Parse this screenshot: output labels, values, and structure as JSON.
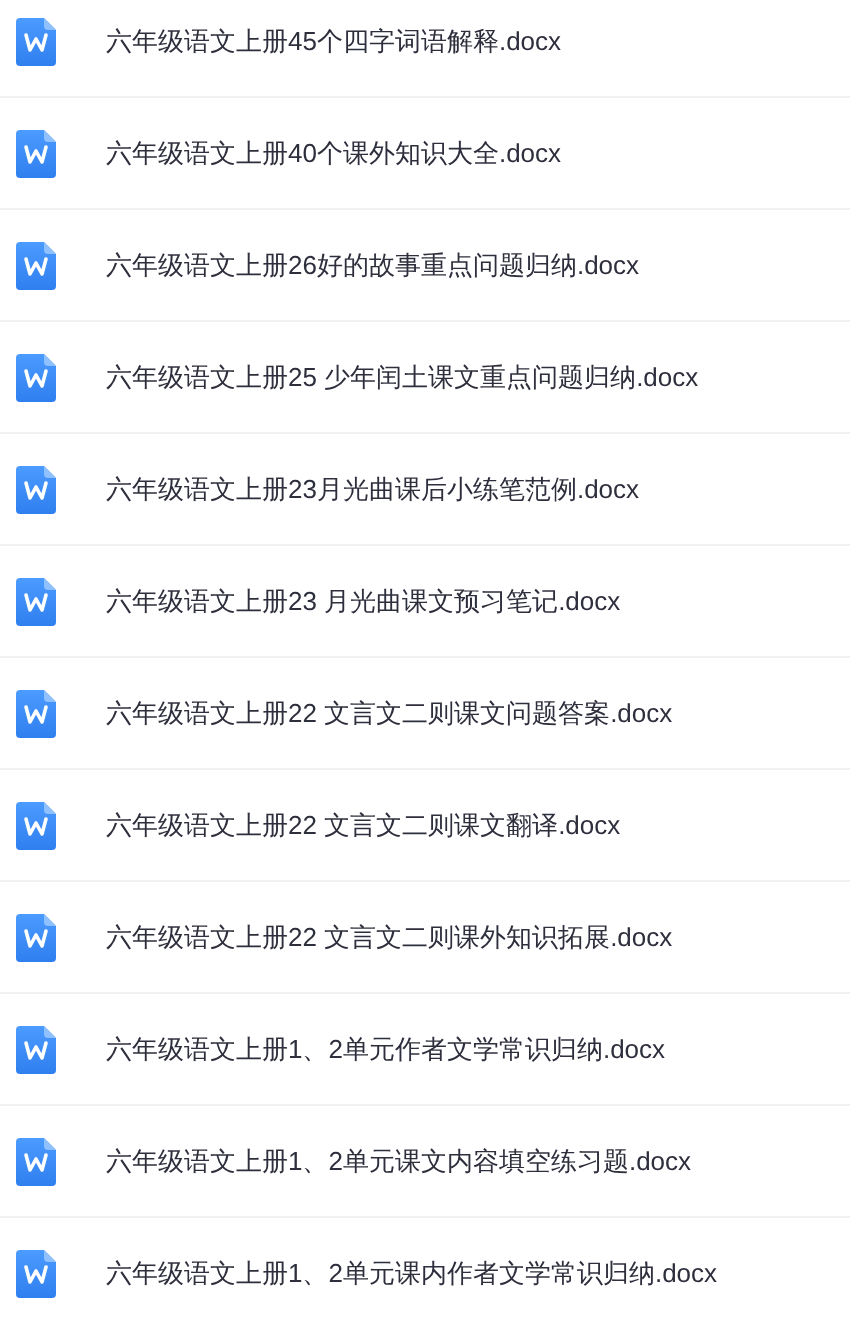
{
  "files": [
    {
      "name": "六年级语文上册45个四字词语解释.docx"
    },
    {
      "name": "六年级语文上册40个课外知识大全.docx"
    },
    {
      "name": "六年级语文上册26好的故事重点问题归纳.docx"
    },
    {
      "name": "六年级语文上册25 少年闰土课文重点问题归纳.docx"
    },
    {
      "name": "六年级语文上册23月光曲课后小练笔范例.docx"
    },
    {
      "name": "六年级语文上册23 月光曲课文预习笔记.docx"
    },
    {
      "name": "六年级语文上册22 文言文二则课文问题答案.docx"
    },
    {
      "name": "六年级语文上册22 文言文二则课文翻译.docx"
    },
    {
      "name": "六年级语文上册22 文言文二则课外知识拓展.docx"
    },
    {
      "name": "六年级语文上册1、2单元作者文学常识归纳.docx"
    },
    {
      "name": "六年级语文上册1、2单元课文内容填空练习题.docx"
    },
    {
      "name": "六年级语文上册1、2单元课内作者文学常识归纳.docx"
    }
  ]
}
